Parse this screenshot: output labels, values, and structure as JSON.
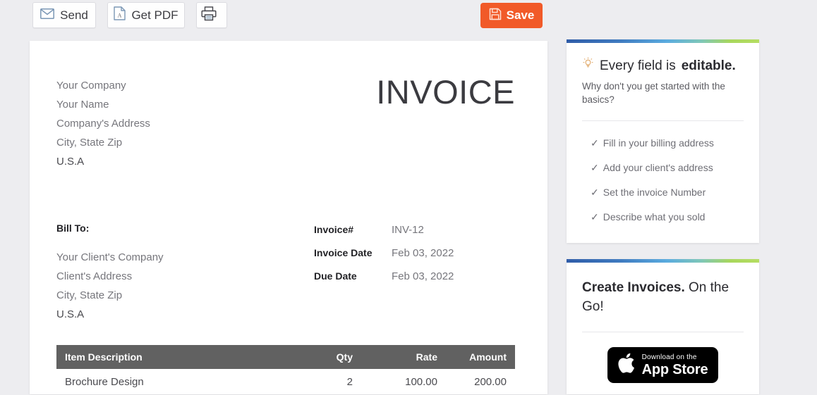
{
  "toolbar": {
    "send_label": "Send",
    "getpdf_label": "Get PDF",
    "print_label": "",
    "save_label": "Save",
    "save_color": "#f15a29"
  },
  "invoice": {
    "title": "INVOICE",
    "company": {
      "lines": [
        "Your Company",
        "Your Name",
        "Company's Address",
        "City, State Zip",
        "U.S.A"
      ]
    },
    "bill_to": {
      "label": "Bill To:",
      "lines": [
        "Your Client's Company",
        "Client's Address",
        "City, State Zip",
        "U.S.A"
      ]
    },
    "meta": [
      {
        "label": "Invoice#",
        "value": "INV-12"
      },
      {
        "label": "Invoice Date",
        "value": "Feb 03, 2022"
      },
      {
        "label": "Due Date",
        "value": "Feb 03, 2022"
      }
    ],
    "table": {
      "headers": {
        "description": "Item Description",
        "qty": "Qty",
        "rate": "Rate",
        "amount": "Amount"
      },
      "header_bg": "#616161",
      "rows": [
        {
          "description": "Brochure Design",
          "qty": "2",
          "rate": "100.00",
          "amount": "200.00"
        }
      ]
    }
  },
  "sidebar": {
    "tips_card": {
      "heading_normal": "Every field is ",
      "heading_bold": "editable.",
      "subtitle": "Why don't you get started with the basics?",
      "items": [
        {
          "check": "✓",
          "label": "Fill in your billing address"
        },
        {
          "check": "✓",
          "label": "Add your client's address"
        },
        {
          "check": "✓",
          "label": "Set the invoice Number"
        },
        {
          "check": "✓",
          "label": "Describe what you sold"
        }
      ]
    },
    "app_card": {
      "heading_bold": "Create Invoices.",
      "heading_normal": " On the Go!",
      "badge_small": "Download on the",
      "badge_big": "App Store"
    }
  }
}
